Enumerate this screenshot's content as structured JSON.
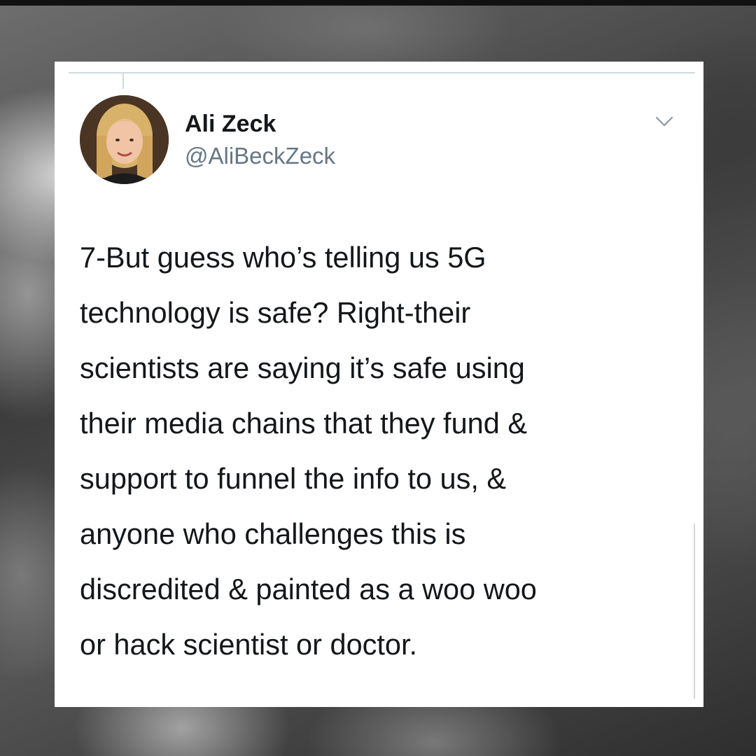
{
  "tweet": {
    "author_name": "Ali Zeck",
    "author_handle": "@AliBeckZeck",
    "text": "7-But guess who’s telling us 5G\ntechnology is safe? Right-their\nscientists are saying it’s safe using\ntheir media chains that they fund &\nsupport to funnel the info to us, &\nanyone who challenges this is\ndiscredited & painted as a woo woo\nor hack scientist or doctor.",
    "avatar_icon": "profile-photo",
    "menu_icon": "chevron-down-icon"
  },
  "colors": {
    "card_background": "#ffffff",
    "name_color": "#14171a",
    "handle_color": "#657786",
    "text_color": "#14171a",
    "background_storm": "#4a4a4a"
  }
}
